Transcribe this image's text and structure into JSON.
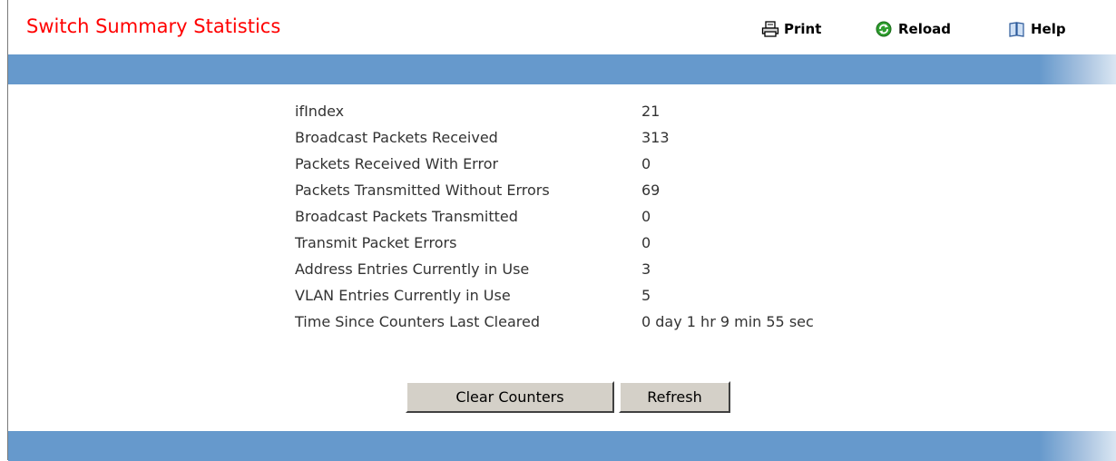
{
  "header": {
    "title": "Switch Summary Statistics",
    "print_label": "Print",
    "reload_label": "Reload",
    "help_label": "Help"
  },
  "colors": {
    "title": "#ff0000",
    "band": "#6699cc",
    "reload_icon": "#2e9e2e"
  },
  "icons": {
    "print": "printer-icon",
    "reload": "reload-icon",
    "help": "book-icon"
  },
  "stats": [
    {
      "label": "ifIndex",
      "value": "21"
    },
    {
      "label": "Broadcast Packets Received",
      "value": "313"
    },
    {
      "label": "Packets Received With Error",
      "value": "0"
    },
    {
      "label": "Packets Transmitted Without Errors",
      "value": "69"
    },
    {
      "label": "Broadcast Packets Transmitted",
      "value": "0"
    },
    {
      "label": "Transmit Packet Errors",
      "value": "0"
    },
    {
      "label": "Address Entries Currently in Use",
      "value": "3"
    },
    {
      "label": "VLAN Entries Currently in Use",
      "value": "5"
    },
    {
      "label": "Time Since Counters Last Cleared",
      "value": "0 day 1 hr 9 min 55 sec"
    }
  ],
  "buttons": {
    "clear_counters": "Clear Counters",
    "refresh": "Refresh"
  }
}
